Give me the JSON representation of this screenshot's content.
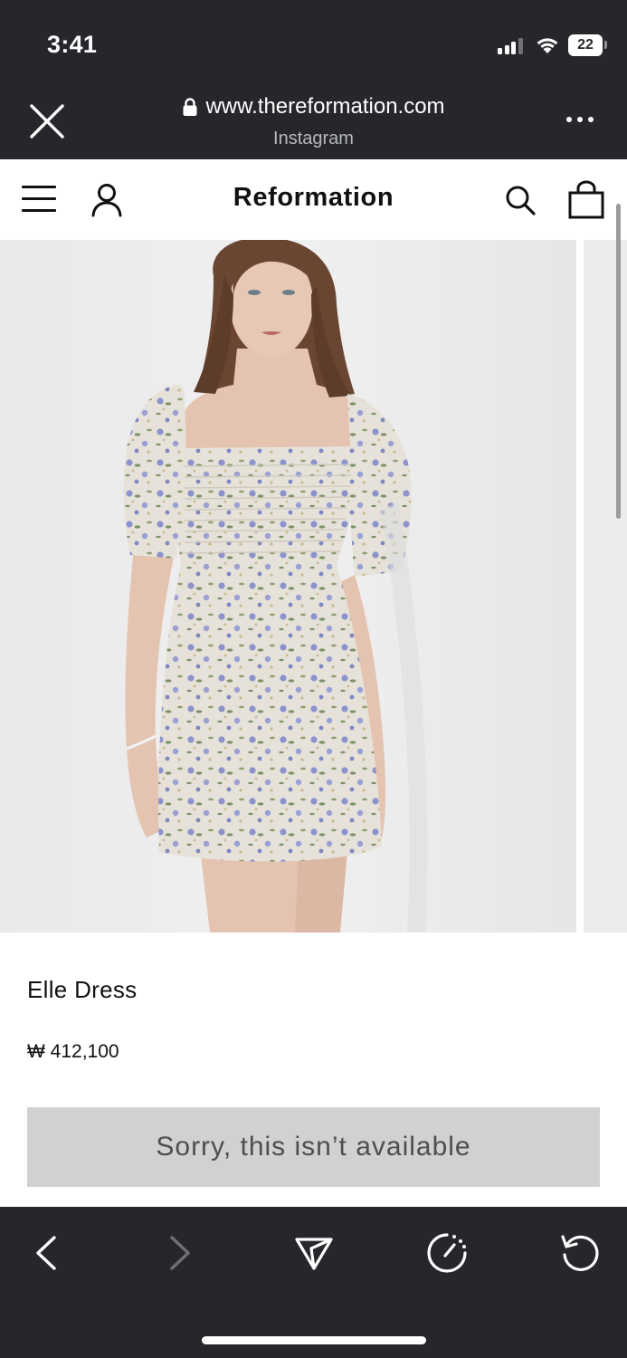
{
  "status_bar": {
    "time": "3:41",
    "battery_level": "22"
  },
  "browser": {
    "url": "www.thereformation.com",
    "source": "Instagram",
    "close_icon": "close-icon",
    "more_icon": "more-icon"
  },
  "site_nav": {
    "brand": "Reformation",
    "icons": [
      "hamburger-menu-icon",
      "account-icon",
      "search-icon",
      "shopping-bag-icon"
    ]
  },
  "product": {
    "name": "Elle Dress",
    "price": "₩ 412,100",
    "button_label": "Sorry, this isn’t available",
    "colors": {
      "dress_base": "#e6e2d9",
      "flower_blue": "#8c93cc",
      "leaf_green": "#7d9168",
      "hair": "#6a4531",
      "skin": "#e4c3b0",
      "background": "#ececec"
    }
  },
  "toolbar": {
    "icons": [
      "back-icon",
      "forward-icon",
      "share-icon",
      "speed-icon",
      "reload-icon"
    ]
  },
  "theme": {
    "chrome_bg": "#25272b",
    "button_bg": "#d1d1d1",
    "button_text": "#4e4e4e"
  }
}
